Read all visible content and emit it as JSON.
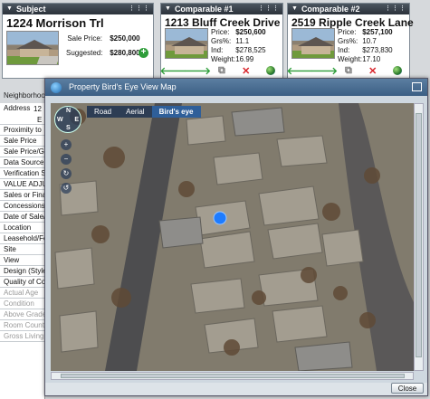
{
  "subject": {
    "header": "Subject",
    "address": "1224 Morrison Trl",
    "sale_price_label": "Sale Price:",
    "sale_price": "$250,000",
    "suggested_label": "Suggested:",
    "suggested": "$280,800"
  },
  "comparables": [
    {
      "header": "Comparable #1",
      "address": "1213 Bluff Creek Drive",
      "rows": [
        {
          "k": "Price:",
          "v": "$250,600"
        },
        {
          "k": "Grs%:",
          "v": "11.1"
        },
        {
          "k": "Ind:",
          "v": "$278,525"
        },
        {
          "k": "Weight:",
          "v": "16.99"
        }
      ]
    },
    {
      "header": "Comparable #2",
      "address": "2519 Ripple Creek Lane",
      "rows": [
        {
          "k": "Price:",
          "v": "$257,100"
        },
        {
          "k": "Grs%:",
          "v": "10.7"
        },
        {
          "k": "Ind:",
          "v": "$273,830"
        },
        {
          "k": "Weight:",
          "v": "17.10"
        }
      ]
    }
  ],
  "left_grid": {
    "neighborhood_label": "Neighborhoo",
    "rows": [
      "Address",
      "Proximity to",
      "Sale Price",
      "Sale Price/Gr",
      "Data Source",
      "Verification S",
      "VALUE ADJUS",
      "Sales or Finar",
      "Concessions",
      "Date of Sale/T",
      "Location",
      "Leasehold/Fee",
      "Site",
      "View",
      "Design (Style",
      "Quality of Con",
      "Actual Age",
      "Condition",
      "Above Grade",
      "Room Count",
      "Gross Living"
    ],
    "address_value": "12",
    "address_value2": "E"
  },
  "map_dialog": {
    "title": "Property Bird's Eye View Map",
    "map_modes": [
      "Road",
      "Aerial",
      "Bird's eye"
    ],
    "active_mode": "Bird's eye",
    "compass": {
      "n": "N",
      "s": "S",
      "e": "E",
      "w": "W"
    },
    "close_label": "Close"
  },
  "colors": {
    "header_dark": "#2b323a",
    "dialog_title": "#3c5f84",
    "subject_pin": "#1e7cff",
    "add_green": "#2e9d3a",
    "remove_red": "#d8242a"
  }
}
